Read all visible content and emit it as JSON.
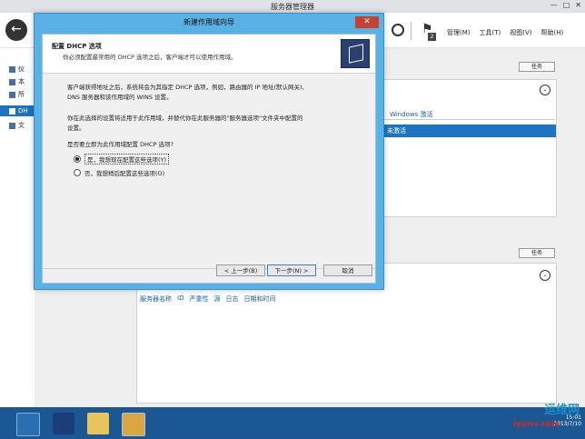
{
  "window": {
    "title": "服务器管理器",
    "min": "—",
    "max": "□",
    "close": "✕"
  },
  "header": {
    "menu": [
      "管理(M)",
      "工具(T)",
      "视图(V)",
      "帮助(H)"
    ],
    "notification_count": "2"
  },
  "sidebar": {
    "items": [
      {
        "label": "仪",
        "icon": "dashboard-icon"
      },
      {
        "label": "本",
        "icon": "server-icon"
      },
      {
        "label": "所",
        "icon": "servers-icon"
      },
      {
        "label": "DH",
        "icon": "dhcp-icon"
      },
      {
        "label": "文",
        "icon": "file-icon"
      }
    ]
  },
  "content": {
    "tasks_label": "任务",
    "windows_activate": "Windows 激活",
    "not_activated": "未激活",
    "columns": [
      "服务器名称",
      "ID",
      "严重性",
      "源",
      "日志",
      "日期和时间"
    ]
  },
  "wizard": {
    "title": "新建作用域向导",
    "heading": "配置 DHCP 选项",
    "subheading": "你必须配置最常用的 DHCP 选项之后，客户端才可以使用作用域。",
    "para1_line1": "客户端获得地址之后，系统将会为其指定 DHCP 选项，例如，路由器的 IP 地址(默认网关)、",
    "para1_line2": "DNS 服务器和该作用域的 WINS 设置。",
    "para2_line1": "你在此选择的设置将适用于此作用域，并替代你在此服务器的\"服务器选项\"文件夹中配置的",
    "para2_line2": "设置。",
    "question": "是否要立即为此作用域配置 DHCP 选项?",
    "option_yes": "是，我想现在配置这些选项(Y)",
    "option_no": "否，我想稍后配置这些选项(O)",
    "selected": "yes",
    "back_btn": "< 上一步(B)",
    "next_btn": "下一步(N) >",
    "cancel_btn": "取消"
  },
  "taskbar": {
    "time": "15:01",
    "date": "2013/7/10"
  },
  "watermark": {
    "line1": "运维网",
    "line2": "iyunv.com"
  }
}
